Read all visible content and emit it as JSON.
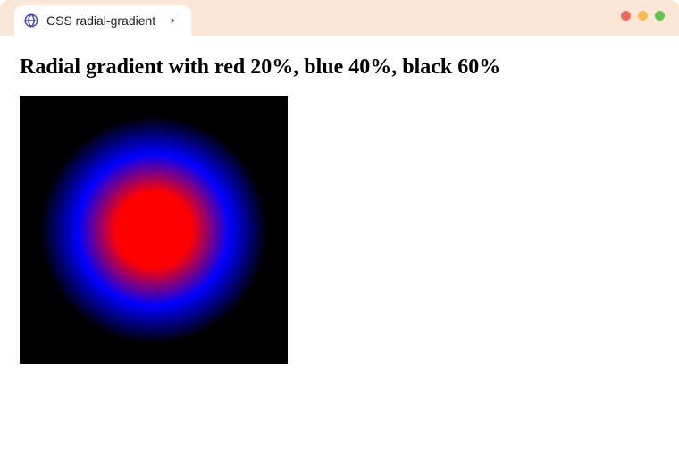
{
  "tab": {
    "title": "CSS radial-gradient"
  },
  "page": {
    "heading": "Radial gradient with red 20%, blue 40%, black 60%"
  },
  "gradient": {
    "stops": [
      {
        "color": "red",
        "pct": 20
      },
      {
        "color": "blue",
        "pct": 40
      },
      {
        "color": "black",
        "pct": 60
      }
    ]
  }
}
